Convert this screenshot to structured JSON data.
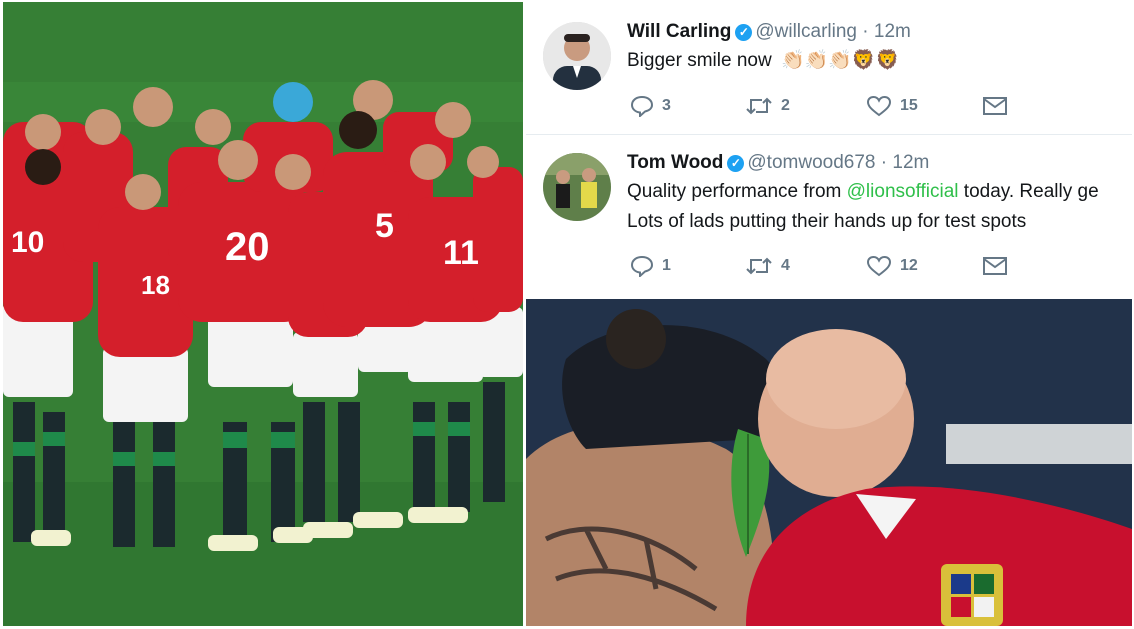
{
  "tweets": [
    {
      "name": "Will Carling",
      "handle": "@willcarling",
      "sep": "·",
      "time": "12m",
      "text": "Bigger smile now",
      "emojis": "👏🏻👏🏻👏🏻🦁🦁",
      "replies": "3",
      "retweets": "2",
      "likes": "15"
    },
    {
      "name": "Tom Wood",
      "handle": "@tomwood678",
      "sep": "·",
      "time": "12m",
      "text_before": "Quality performance from ",
      "mention": "@lionsofficial",
      "text_after": " today. Really ge",
      "text_line2": "Lots of lads putting their hands up for test spots",
      "replies": "1",
      "retweets": "4",
      "likes": "12"
    }
  ],
  "icons": {
    "reply": "speech-bubble",
    "retweet": "retweet-arrows",
    "like": "heart",
    "message": "envelope"
  },
  "colors": {
    "twitter_blue": "#1da1f2",
    "mention_green": "#2fbf4a",
    "lions_red": "#c8102e",
    "pitch_green": "#3d8d3c"
  }
}
